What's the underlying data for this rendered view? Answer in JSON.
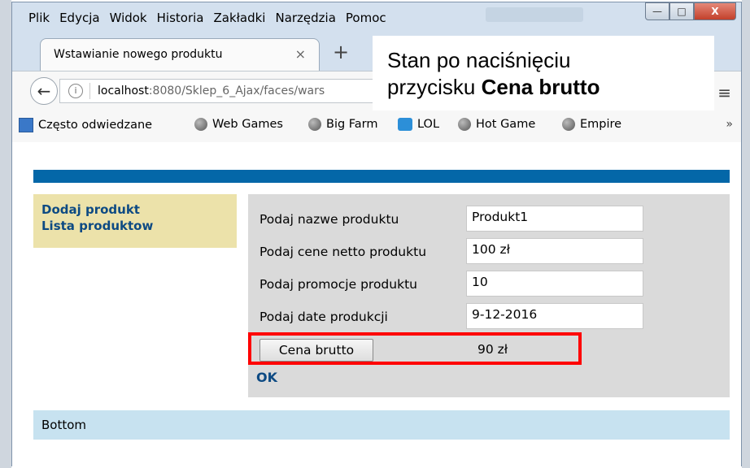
{
  "menu": [
    "Plik",
    "Edycja",
    "Widok",
    "Historia",
    "Zakładki",
    "Narzędzia",
    "Pomoc"
  ],
  "window_buttons": {
    "minimize": "—",
    "maximize": "□",
    "close": "X"
  },
  "tab": {
    "title": "Wstawianie nowego produktu",
    "close": "×",
    "new_tab": "+"
  },
  "nav": {
    "back": "←",
    "info": "i",
    "url_host": "localhost",
    "url_rest": ":8080/Sklep_6_Ajax/faces/wars",
    "menu": "≡"
  },
  "bookmarks": [
    "Często odwiedzane",
    "Web Games",
    "Big Farm",
    "LOL",
    "Hot Game",
    "Empire"
  ],
  "bookmarks_more": "»",
  "page": {
    "sidebar": [
      "Dodaj produkt",
      "Lista produktow"
    ],
    "form": {
      "rows": [
        {
          "label": "Podaj nazwe produktu",
          "value": "Produkt1"
        },
        {
          "label": "Podaj cene netto produktu",
          "value": "100 zł"
        },
        {
          "label": "Podaj promocje produktu",
          "value": "10"
        },
        {
          "label": "Podaj date produkcji",
          "value": "9-12-2016"
        }
      ],
      "button": "Cena brutto",
      "result": "90 zł",
      "ok": "OK"
    },
    "bottom": "Bottom"
  },
  "annotation": {
    "line1": "Stan po naciśnięciu",
    "line2_prefix": "przycisku ",
    "line2_bold": "Cena brutto"
  },
  "colors": {
    "header_bar": "#0467a8",
    "sidebar_bg": "#ece2aa",
    "link": "#0d4a83",
    "highlight": "#ff0000",
    "bottom_bg": "#c7e2f0"
  }
}
